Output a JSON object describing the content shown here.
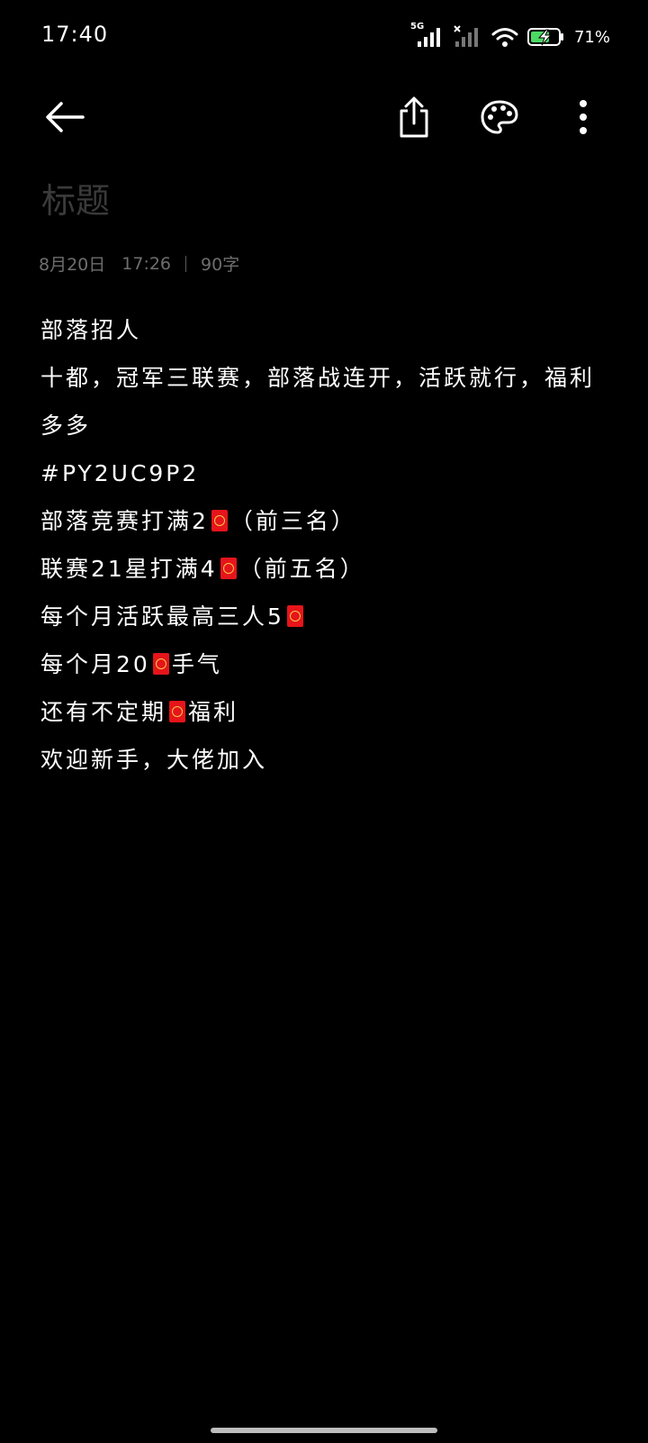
{
  "status_bar": {
    "time": "17:40",
    "network_type": "5G",
    "battery_percent": "71%",
    "icons": [
      "signal-5g-icon",
      "signal-no-sim-icon",
      "wifi-icon",
      "battery-charging-icon"
    ]
  },
  "toolbar": {
    "icons": [
      "back-arrow-icon",
      "share-icon",
      "palette-icon",
      "more-vertical-icon"
    ]
  },
  "note": {
    "title_placeholder": "标题",
    "date": "8月20日",
    "time": "17:26",
    "char_count": "90字",
    "lines": {
      "l1": "部落招人",
      "l2": "十都，冠军三联赛，部落战连开，活跃就行，福利多多",
      "l3": "#PY2UC9P2",
      "l4a": "部落竞赛打满2",
      "l4b": "（前三名）",
      "l5a": "联赛21星打满4",
      "l5b": "（前五名）",
      "l6a": "每个月活跃最高三人5",
      "l7a": "每个月20",
      "l7b": "手气",
      "l8a": "还有不定期",
      "l8b": "福利",
      "l9": "欢迎新手，大佬加入"
    },
    "emoji_name": "red-envelope-icon"
  },
  "colors": {
    "background": "#000000",
    "text": "#ffffff",
    "placeholder": "#3a3a3a",
    "meta": "#6e6e6e",
    "red_envelope": "#e6141b"
  }
}
